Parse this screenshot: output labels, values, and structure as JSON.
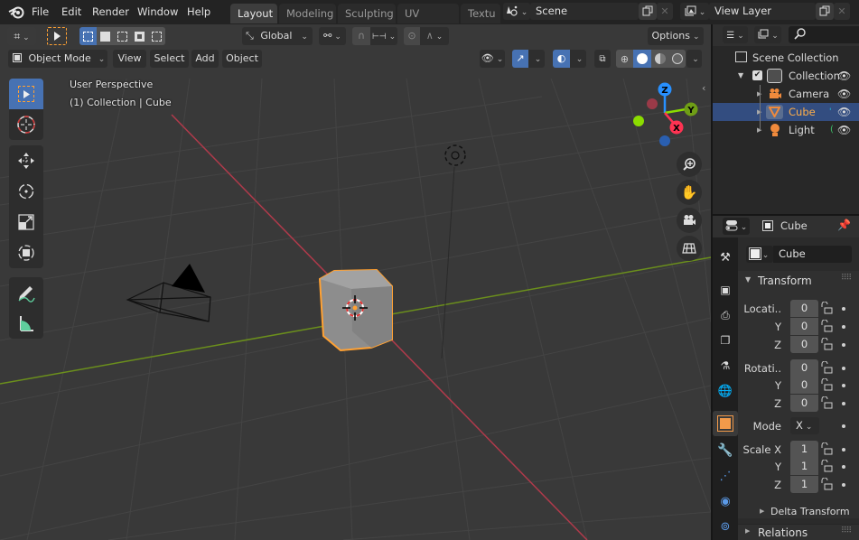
{
  "topbar": {
    "menus": [
      "File",
      "Edit",
      "Render",
      "Window",
      "Help"
    ],
    "workspace_tabs": [
      {
        "label": "Layout",
        "active": true
      },
      {
        "label": "Modeling",
        "active": false
      },
      {
        "label": "Sculpting",
        "active": false
      },
      {
        "label": "UV Editing",
        "active": false
      },
      {
        "label": "Textu",
        "active": false
      }
    ],
    "scene": {
      "icon": "scene-icon",
      "value": "Scene"
    },
    "view_layer": {
      "icon": "view-layer-icon",
      "value": "View Layer"
    }
  },
  "viewport_header": {
    "transform_orientation": "Global",
    "options_label": "Options",
    "mode": "Object Mode",
    "menus": [
      "View",
      "Select",
      "Add",
      "Object"
    ],
    "shading_modes": [
      "wireframe",
      "solid",
      "material-preview",
      "rendered"
    ],
    "active_shading": "solid"
  },
  "viewport": {
    "view_name": "User Perspective",
    "context": "(1) Collection | Cube",
    "gizmo_axes": {
      "x": "X",
      "y": "Y",
      "z": "Z"
    },
    "colors": {
      "x_axis": "#ff3352",
      "y_axis": "#8bdc00",
      "z_axis": "#2890ff",
      "selection": "#ffa133",
      "grid_bg": "#393939"
    },
    "tools": [
      "select-box",
      "cursor",
      "move",
      "rotate",
      "scale",
      "transform",
      "annotate",
      "measure"
    ],
    "active_tool": "select-box",
    "nav_buttons": [
      "zoom",
      "pan",
      "camera-view",
      "orthographic-toggle"
    ]
  },
  "outliner": {
    "search_placeholder": "",
    "root": "Scene Collection",
    "items": [
      {
        "label": "Collection",
        "type": "collection",
        "indent": 1,
        "selected": false
      },
      {
        "label": "Camera",
        "type": "camera",
        "indent": 2,
        "selected": false
      },
      {
        "label": "Cube",
        "type": "mesh",
        "indent": 2,
        "selected": true
      },
      {
        "label": "Light",
        "type": "light",
        "indent": 2,
        "selected": false
      }
    ]
  },
  "properties": {
    "header_object": "Cube",
    "object_name": "Cube",
    "tabs": [
      "tool",
      "render",
      "output",
      "view-layer",
      "scene",
      "world",
      "object",
      "modifiers",
      "particles",
      "physics",
      "constraints"
    ],
    "active_tab": "object",
    "transform_title": "Transform",
    "location": {
      "label": "Locati..",
      "x": "0",
      "y": "0",
      "z": "0"
    },
    "rotation": {
      "label": "Rotati..",
      "x": "0",
      "y": "0",
      "z": "0"
    },
    "mode": {
      "label": "Mode",
      "value": "X"
    },
    "scale": {
      "label": "Scale X",
      "x": "1",
      "y": "1",
      "z": "1"
    },
    "axis_labels": {
      "y": "Y",
      "z": "Z"
    },
    "delta_transform": "Delta Transform",
    "relations": "Relations"
  }
}
